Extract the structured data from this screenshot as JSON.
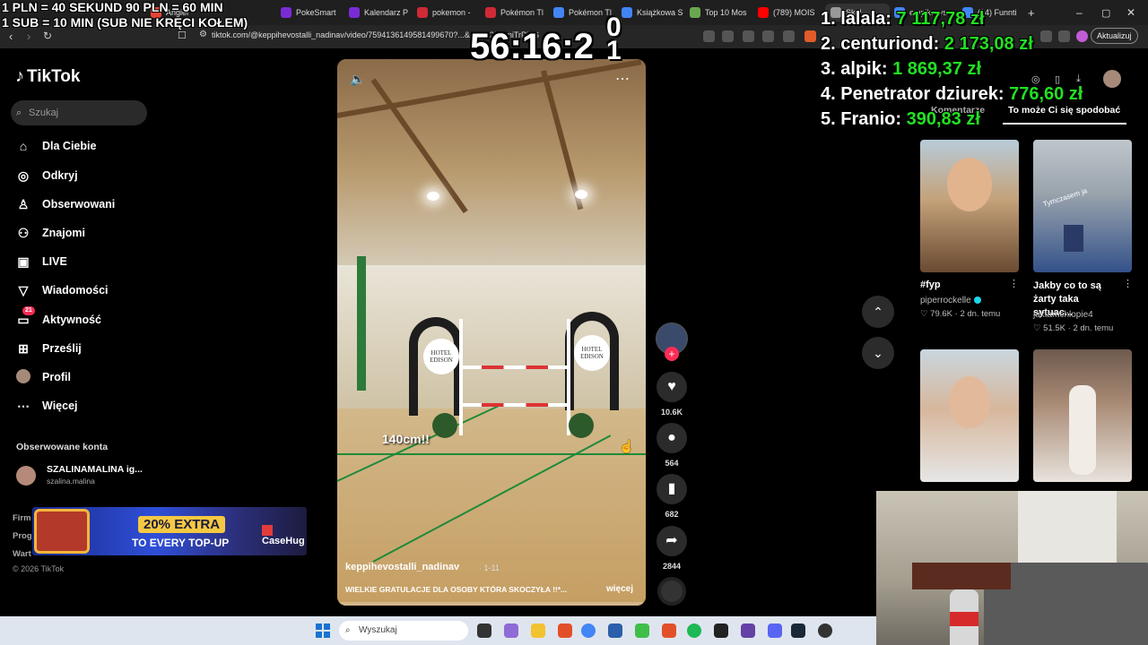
{
  "browser": {
    "tabs": [
      {
        "label": "Angiel",
        "color": "#ea4335"
      },
      {
        "label": "PokeSmart",
        "color": "#7b2bd6"
      },
      {
        "label": "Kalendarz P",
        "color": "#7b2bd6"
      },
      {
        "label": "pokemon -",
        "color": "#cf2a36"
      },
      {
        "label": "Pokémon Tl",
        "color": "#cf2a36"
      },
      {
        "label": "Pokémon Tl",
        "color": "#4285f4"
      },
      {
        "label": "Książkowa S",
        "color": "#4285f4"
      },
      {
        "label": "Top 10 Mos",
        "color": "#6aa84f"
      },
      {
        "label": "(789) MOIS",
        "color": "#ff0000"
      },
      {
        "label": "Skel",
        "color": "#999999"
      },
      {
        "label": "empik.wys",
        "color": "#4285f4"
      },
      {
        "label": "(14) Funnti",
        "color": "#4285f4"
      }
    ],
    "url": "tiktok.com/@keppihevostalli_nadinav/video/7594136149581499670?...&...N-92%JmiTrP%S",
    "update_label": "Aktualizuj"
  },
  "overlay": {
    "line1": "1 PLN = 40 SEKUND 90 PLN = 60 MIN",
    "line2": "1 SUB = 10 MIN (SUB NIE KRĘCI KOŁEM)",
    "timer": "56:16:2",
    "timer_extra_top": "0",
    "timer_extra_bottom": "1",
    "leaderboard": [
      {
        "rank": "1.",
        "name": "lalala:",
        "amount": "7 117,78 zł"
      },
      {
        "rank": "2.",
        "name": "centuriond:",
        "amount": "2 173,08 zł"
      },
      {
        "rank": "3.",
        "name": "alpik:",
        "amount": "1 869,37 zł"
      },
      {
        "rank": "4.",
        "name": "Penetrator dziurek:",
        "amount": "776,60 zł"
      },
      {
        "rank": "5.",
        "name": "Franio:",
        "amount": "390,83 zł"
      }
    ]
  },
  "tiktok": {
    "logo": "TikTok",
    "search_placeholder": "Szukaj",
    "nav": [
      {
        "label": "Dla Ciebie",
        "icon": "home-icon"
      },
      {
        "label": "Odkryj",
        "icon": "compass-icon"
      },
      {
        "label": "Obserwowani",
        "icon": "following-icon"
      },
      {
        "label": "Znajomi",
        "icon": "friends-icon"
      },
      {
        "label": "LIVE",
        "icon": "live-icon"
      },
      {
        "label": "Wiadomości",
        "icon": "messages-icon"
      },
      {
        "label": "Aktywność",
        "icon": "activity-icon",
        "badge": "21"
      },
      {
        "label": "Prześlij",
        "icon": "upload-icon"
      },
      {
        "label": "Profil",
        "icon": "profile-icon"
      },
      {
        "label": "Więcej",
        "icon": "more-icon"
      }
    ],
    "followed_title": "Obserwowane konta",
    "followed": [
      {
        "name": "SZALINAMALINA ig...",
        "handle": "szalina.malina"
      }
    ],
    "footer": [
      "Firm",
      "Prog",
      "Wart"
    ],
    "copyright": "© 2026 TikTok",
    "ad": {
      "extra": "20% EXTRA",
      "topup": "TO EVERY TOP-UP",
      "brand": "CaseHug"
    },
    "video": {
      "caption": "140cm!!",
      "author": "keppihevostalli_nadinav",
      "time": "· 1-11",
      "description": "WIELKIE GRATULACJE DLA OSOBY KTÓRA SKOCZYŁA !!*...",
      "more": "więcej",
      "logo_text": "HOTEL EDISON"
    },
    "actions": {
      "likes": "10.6K",
      "comments": "564",
      "saves": "682",
      "shares": "2844"
    },
    "right_tabs": [
      "Komentarze",
      "To może Ci się spodobać"
    ],
    "cards": [
      {
        "title": "#fyp",
        "author": "piperrockelle",
        "verified": true,
        "likes": "79.6K",
        "age": "2 dn. temu"
      },
      {
        "title": "Jakby co to są żarty taka sytuac...",
        "author": "jaktamchlopie4",
        "verified": false,
        "likes": "51.5K",
        "age": "2 dn. temu",
        "overlay": "Tymczasem ja"
      },
      {
        "title": "",
        "author": "",
        "likes": "",
        "age": ""
      },
      {
        "title": "",
        "author": "",
        "likes": "",
        "age": ""
      }
    ]
  },
  "taskbar": {
    "search_placeholder": "Wyszukaj"
  }
}
